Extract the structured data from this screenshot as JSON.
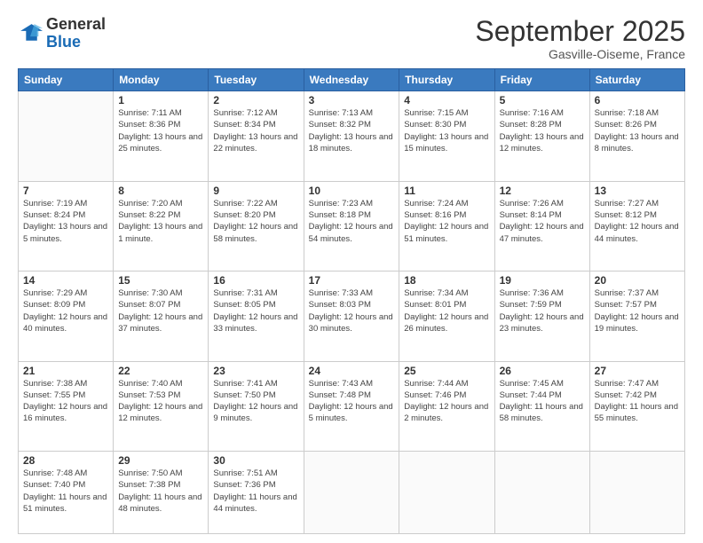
{
  "logo": {
    "general": "General",
    "blue": "Blue"
  },
  "header": {
    "title": "September 2025",
    "subtitle": "Gasville-Oiseme, France"
  },
  "weekdays": [
    "Sunday",
    "Monday",
    "Tuesday",
    "Wednesday",
    "Thursday",
    "Friday",
    "Saturday"
  ],
  "weeks": [
    [
      {
        "day": "",
        "info": ""
      },
      {
        "day": "1",
        "info": "Sunrise: 7:11 AM\nSunset: 8:36 PM\nDaylight: 13 hours and 25 minutes."
      },
      {
        "day": "2",
        "info": "Sunrise: 7:12 AM\nSunset: 8:34 PM\nDaylight: 13 hours and 22 minutes."
      },
      {
        "day": "3",
        "info": "Sunrise: 7:13 AM\nSunset: 8:32 PM\nDaylight: 13 hours and 18 minutes."
      },
      {
        "day": "4",
        "info": "Sunrise: 7:15 AM\nSunset: 8:30 PM\nDaylight: 13 hours and 15 minutes."
      },
      {
        "day": "5",
        "info": "Sunrise: 7:16 AM\nSunset: 8:28 PM\nDaylight: 13 hours and 12 minutes."
      },
      {
        "day": "6",
        "info": "Sunrise: 7:18 AM\nSunset: 8:26 PM\nDaylight: 13 hours and 8 minutes."
      }
    ],
    [
      {
        "day": "7",
        "info": "Sunrise: 7:19 AM\nSunset: 8:24 PM\nDaylight: 13 hours and 5 minutes."
      },
      {
        "day": "8",
        "info": "Sunrise: 7:20 AM\nSunset: 8:22 PM\nDaylight: 13 hours and 1 minute."
      },
      {
        "day": "9",
        "info": "Sunrise: 7:22 AM\nSunset: 8:20 PM\nDaylight: 12 hours and 58 minutes."
      },
      {
        "day": "10",
        "info": "Sunrise: 7:23 AM\nSunset: 8:18 PM\nDaylight: 12 hours and 54 minutes."
      },
      {
        "day": "11",
        "info": "Sunrise: 7:24 AM\nSunset: 8:16 PM\nDaylight: 12 hours and 51 minutes."
      },
      {
        "day": "12",
        "info": "Sunrise: 7:26 AM\nSunset: 8:14 PM\nDaylight: 12 hours and 47 minutes."
      },
      {
        "day": "13",
        "info": "Sunrise: 7:27 AM\nSunset: 8:12 PM\nDaylight: 12 hours and 44 minutes."
      }
    ],
    [
      {
        "day": "14",
        "info": "Sunrise: 7:29 AM\nSunset: 8:09 PM\nDaylight: 12 hours and 40 minutes."
      },
      {
        "day": "15",
        "info": "Sunrise: 7:30 AM\nSunset: 8:07 PM\nDaylight: 12 hours and 37 minutes."
      },
      {
        "day": "16",
        "info": "Sunrise: 7:31 AM\nSunset: 8:05 PM\nDaylight: 12 hours and 33 minutes."
      },
      {
        "day": "17",
        "info": "Sunrise: 7:33 AM\nSunset: 8:03 PM\nDaylight: 12 hours and 30 minutes."
      },
      {
        "day": "18",
        "info": "Sunrise: 7:34 AM\nSunset: 8:01 PM\nDaylight: 12 hours and 26 minutes."
      },
      {
        "day": "19",
        "info": "Sunrise: 7:36 AM\nSunset: 7:59 PM\nDaylight: 12 hours and 23 minutes."
      },
      {
        "day": "20",
        "info": "Sunrise: 7:37 AM\nSunset: 7:57 PM\nDaylight: 12 hours and 19 minutes."
      }
    ],
    [
      {
        "day": "21",
        "info": "Sunrise: 7:38 AM\nSunset: 7:55 PM\nDaylight: 12 hours and 16 minutes."
      },
      {
        "day": "22",
        "info": "Sunrise: 7:40 AM\nSunset: 7:53 PM\nDaylight: 12 hours and 12 minutes."
      },
      {
        "day": "23",
        "info": "Sunrise: 7:41 AM\nSunset: 7:50 PM\nDaylight: 12 hours and 9 minutes."
      },
      {
        "day": "24",
        "info": "Sunrise: 7:43 AM\nSunset: 7:48 PM\nDaylight: 12 hours and 5 minutes."
      },
      {
        "day": "25",
        "info": "Sunrise: 7:44 AM\nSunset: 7:46 PM\nDaylight: 12 hours and 2 minutes."
      },
      {
        "day": "26",
        "info": "Sunrise: 7:45 AM\nSunset: 7:44 PM\nDaylight: 11 hours and 58 minutes."
      },
      {
        "day": "27",
        "info": "Sunrise: 7:47 AM\nSunset: 7:42 PM\nDaylight: 11 hours and 55 minutes."
      }
    ],
    [
      {
        "day": "28",
        "info": "Sunrise: 7:48 AM\nSunset: 7:40 PM\nDaylight: 11 hours and 51 minutes."
      },
      {
        "day": "29",
        "info": "Sunrise: 7:50 AM\nSunset: 7:38 PM\nDaylight: 11 hours and 48 minutes."
      },
      {
        "day": "30",
        "info": "Sunrise: 7:51 AM\nSunset: 7:36 PM\nDaylight: 11 hours and 44 minutes."
      },
      {
        "day": "",
        "info": ""
      },
      {
        "day": "",
        "info": ""
      },
      {
        "day": "",
        "info": ""
      },
      {
        "day": "",
        "info": ""
      }
    ]
  ]
}
